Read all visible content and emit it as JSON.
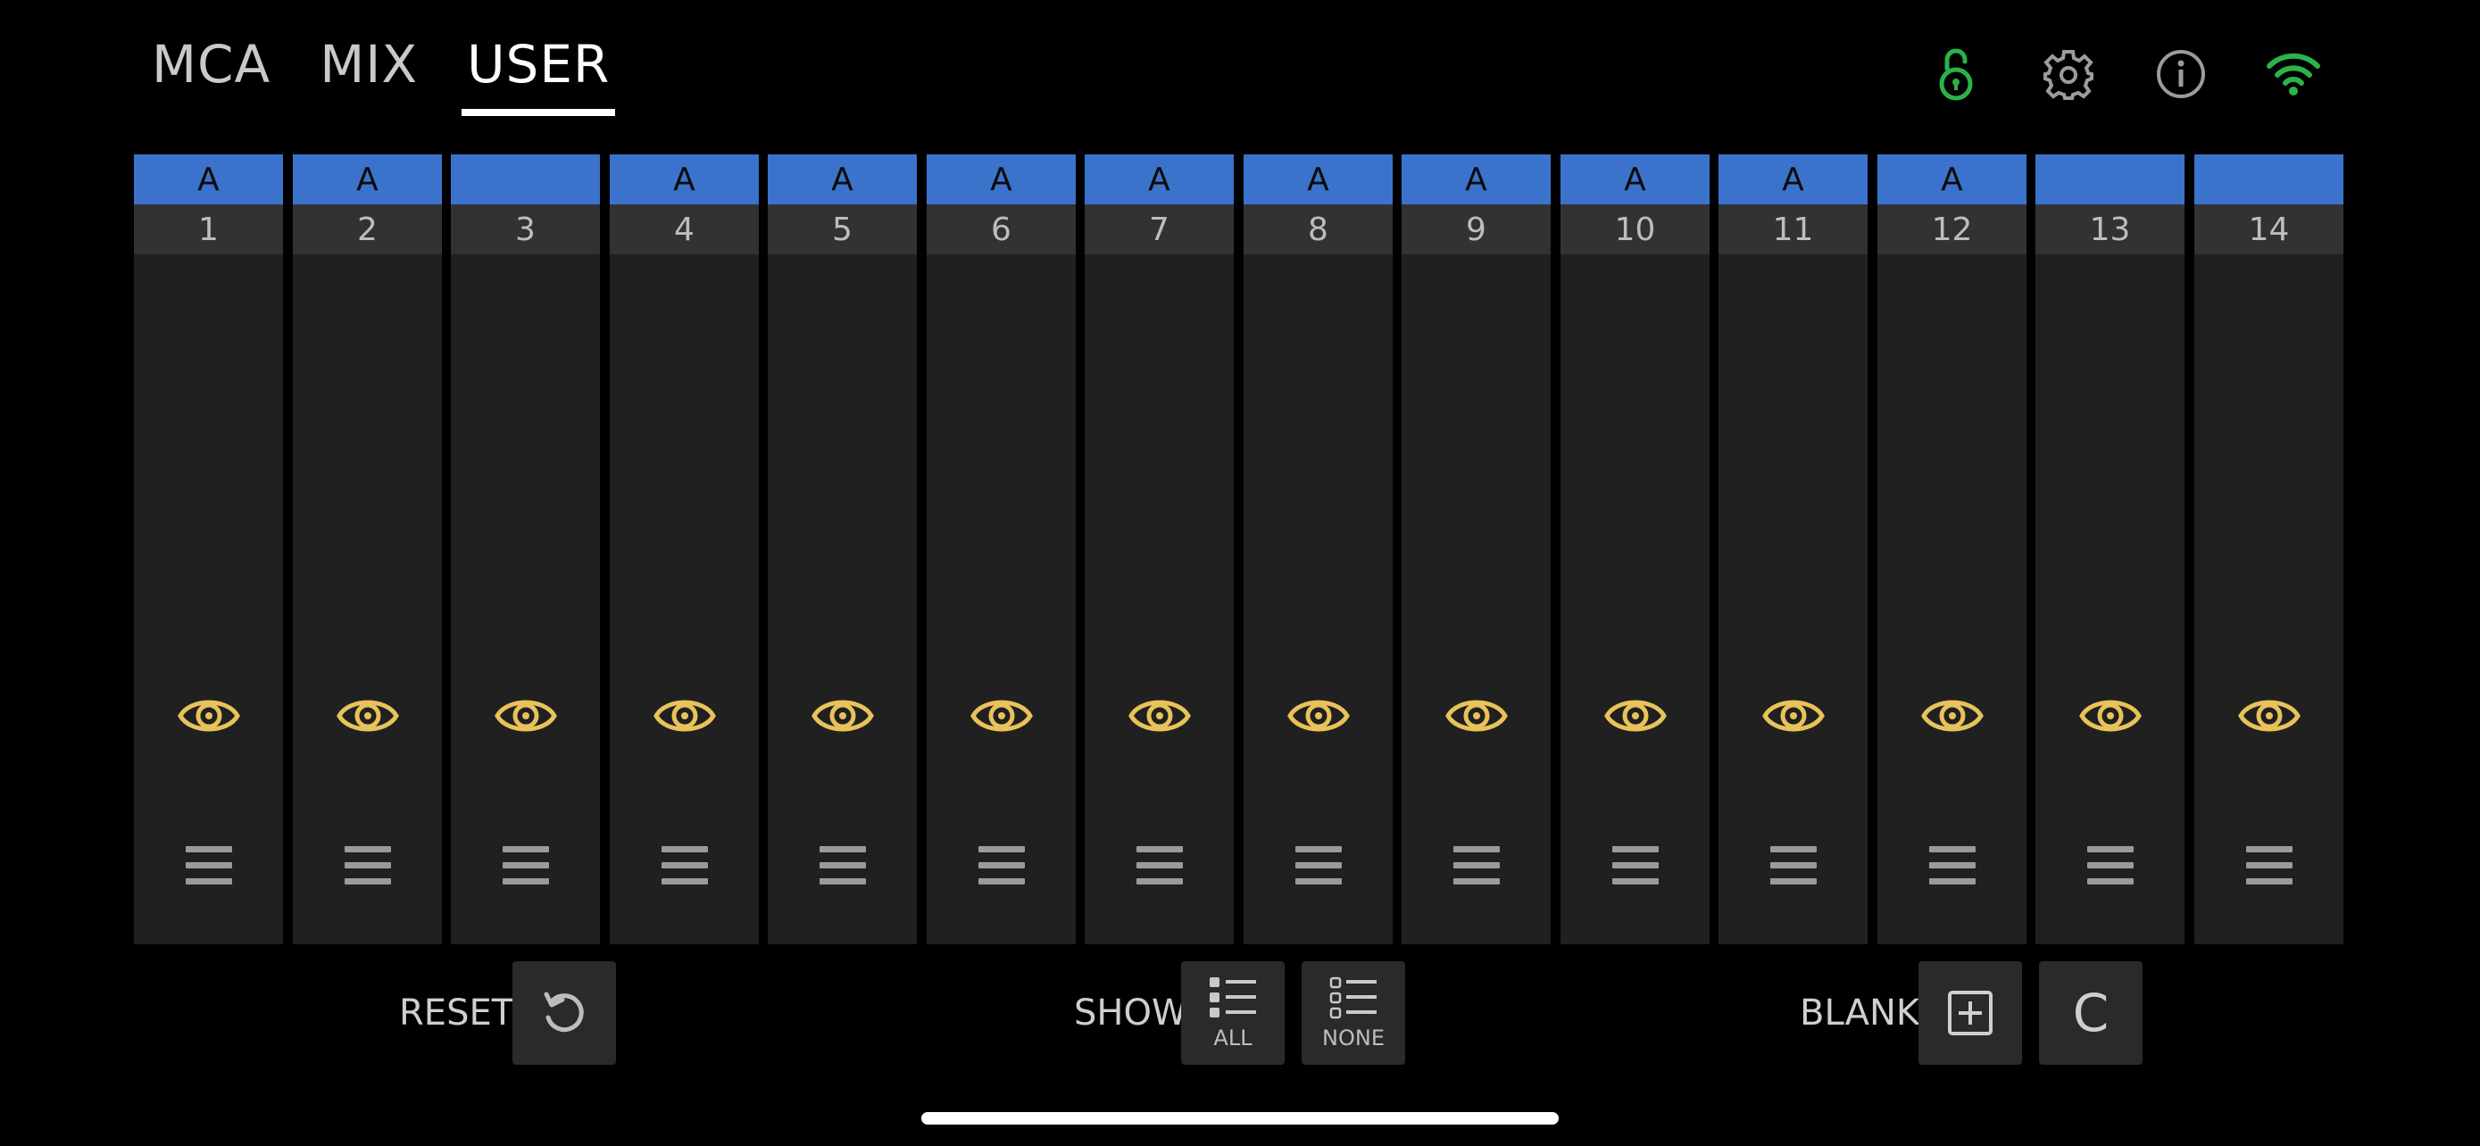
{
  "tabs": [
    {
      "label": "MCA",
      "active": false
    },
    {
      "label": "MIX",
      "active": false
    },
    {
      "label": "USER",
      "active": true
    }
  ],
  "top_icons": [
    "unlocked-padlock-icon",
    "gear-icon",
    "info-icon",
    "wifi-icon"
  ],
  "colors": {
    "accent_green": "#2bb34a",
    "header_blue": "#3b73cc",
    "eye_yellow": "#e8c25a"
  },
  "strips": [
    {
      "tag": "A",
      "number": "1"
    },
    {
      "tag": "A",
      "number": "2"
    },
    {
      "tag": "",
      "number": "3"
    },
    {
      "tag": "A",
      "number": "4"
    },
    {
      "tag": "A",
      "number": "5"
    },
    {
      "tag": "A",
      "number": "6"
    },
    {
      "tag": "A",
      "number": "7"
    },
    {
      "tag": "A",
      "number": "8"
    },
    {
      "tag": "A",
      "number": "9"
    },
    {
      "tag": "A",
      "number": "10"
    },
    {
      "tag": "A",
      "number": "11"
    },
    {
      "tag": "A",
      "number": "12"
    },
    {
      "tag": "",
      "number": "13"
    },
    {
      "tag": "",
      "number": "14"
    }
  ],
  "bottom": {
    "reset_label": "RESET",
    "show_label": "SHOW",
    "show_all": "ALL",
    "show_none": "NONE",
    "blank_label": "BLANK",
    "clear_button": "C"
  }
}
